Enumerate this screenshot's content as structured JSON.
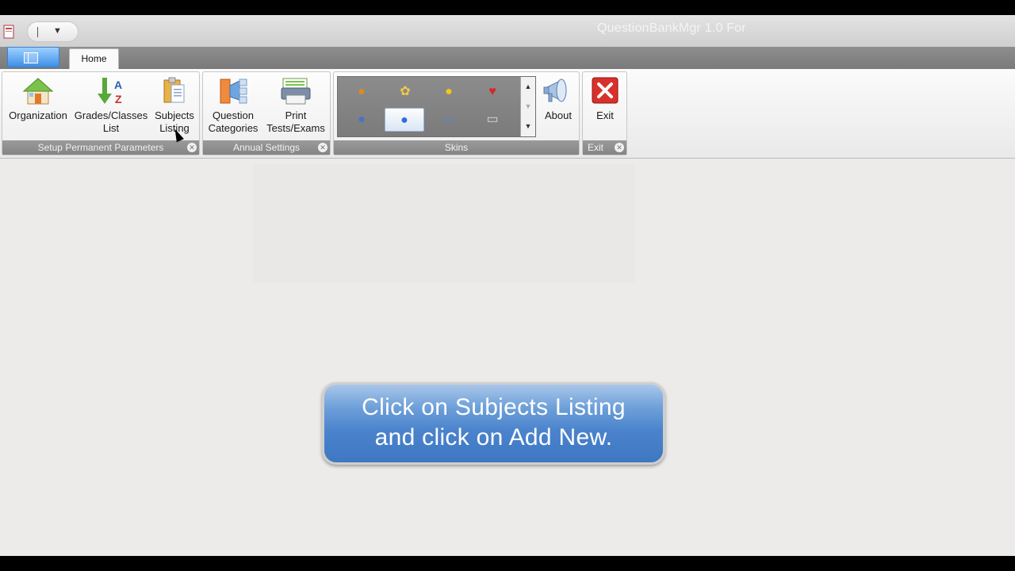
{
  "window": {
    "title": "QuestionBankMgr 1.0 For"
  },
  "tabs": [
    {
      "label": "Home"
    }
  ],
  "ribbon": {
    "groups": {
      "setup": {
        "label": "Setup Permanent Parameters",
        "buttons": {
          "organization": {
            "label": "Organization",
            "icon": "house-icon"
          },
          "grades": {
            "line1": "Grades/Classes",
            "line2": "List",
            "icon": "sort-az-icon"
          },
          "subjects": {
            "line1": "Subjects",
            "line2": "Listing",
            "icon": "clipboard-icon"
          }
        }
      },
      "annual": {
        "label": "Annual Settings",
        "buttons": {
          "categories": {
            "line1": "Question",
            "line2": "Categories",
            "icon": "categories-icon"
          },
          "print": {
            "line1": "Print",
            "line2": "Tests/Exams",
            "icon": "printer-icon"
          }
        }
      },
      "skins": {
        "label": "Skins",
        "items": [
          {
            "glyph": "●",
            "color": "#e08a1e"
          },
          {
            "glyph": "✿",
            "color": "#f2c94c"
          },
          {
            "glyph": "●",
            "color": "#f5c518"
          },
          {
            "glyph": "♥",
            "color": "#d7262e"
          },
          {
            "glyph": "●",
            "color": "#4a72c4"
          },
          {
            "glyph": "●",
            "color": "#2f6fd8"
          },
          {
            "glyph": "▭",
            "color": "#5c84c8"
          },
          {
            "glyph": "▭",
            "color": "#d9d9d9"
          }
        ],
        "selected_index": 5
      },
      "about": {
        "label": "About",
        "icon": "megaphone-icon"
      },
      "exit": {
        "label": "Exit",
        "button_label": "Exit",
        "icon": "close-icon"
      }
    }
  },
  "callout": {
    "line1": "Click on Subjects Listing",
    "line2": "and click on Add New."
  },
  "colors": {
    "accent": "#4a83cc",
    "exit_red": "#d9302c"
  }
}
